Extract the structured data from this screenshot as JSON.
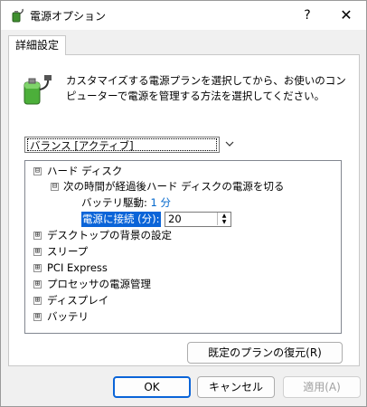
{
  "window": {
    "title": "電源オプション",
    "help_glyph": "?",
    "close_glyph": "✕"
  },
  "tabs": [
    {
      "label": "詳細設定"
    }
  ],
  "description": "カスタマイズする電源プランを選択してから、お使いのコンピューターで電源を管理する方法を選択してください。",
  "plan_select": {
    "value": "バランス [アクティブ]"
  },
  "tree": {
    "hard_disk": {
      "label": "ハード ディスク",
      "expanded": true
    },
    "turn_off_after": {
      "label": "次の時間が経過後ハード ディスクの電源を切る",
      "expanded": true
    },
    "on_battery": {
      "label": "バッテリ駆動:",
      "value": "1 分"
    },
    "plugged_in": {
      "label": "電源に接続 (分):",
      "value": "20"
    },
    "desktop_bg": {
      "label": "デスクトップの背景の設定"
    },
    "sleep": {
      "label": "スリープ"
    },
    "pci_express": {
      "label": "PCI Express"
    },
    "processor_power": {
      "label": "プロセッサの電源管理"
    },
    "display": {
      "label": "ディスプレイ"
    },
    "battery": {
      "label": "バッテリ"
    }
  },
  "buttons": {
    "restore_defaults": "既定のプランの復元(R)",
    "ok": "OK",
    "cancel": "キャンセル",
    "apply": "適用(A)"
  },
  "icons": {
    "expand": "⊞",
    "collapse": "⊟"
  }
}
